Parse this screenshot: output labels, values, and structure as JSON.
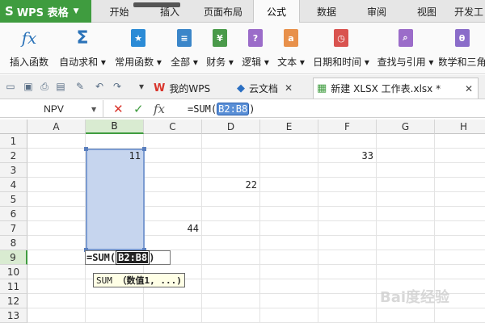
{
  "app": {
    "name": "WPS 表格",
    "logo": "S"
  },
  "menu_tabs": [
    {
      "label": "开始"
    },
    {
      "label": "插入"
    },
    {
      "label": "页面布局"
    },
    {
      "label": "公式"
    },
    {
      "label": "数据"
    },
    {
      "label": "审阅"
    },
    {
      "label": "视图"
    },
    {
      "label": "开发工"
    }
  ],
  "ribbon": [
    {
      "label": "插入函数",
      "icon": "fx-icon"
    },
    {
      "label": "自动求和",
      "icon": "sigma-icon",
      "color": "#2a72b8"
    },
    {
      "label": "常用函数",
      "icon": "star-doc-icon",
      "color": "#2b8bd6"
    },
    {
      "label": "全部",
      "icon": "list-doc-icon",
      "color": "#3b86c9"
    },
    {
      "label": "财务",
      "icon": "money-doc-icon",
      "color": "#4a9a4a"
    },
    {
      "label": "逻辑",
      "icon": "question-doc-icon",
      "color": "#9b6cc9"
    },
    {
      "label": "文本",
      "icon": "text-doc-icon",
      "color": "#e8904a"
    },
    {
      "label": "日期和时间",
      "icon": "clock-doc-icon",
      "color": "#d9534f"
    },
    {
      "label": "查找与引用",
      "icon": "search-doc-icon",
      "color": "#9b6cc9"
    },
    {
      "label": "数学和三角",
      "icon": "theta-doc-icon",
      "color": "#8a6cc9"
    }
  ],
  "doc_tabs": [
    {
      "label": "我的WPS",
      "icon": "wps-logo-icon"
    },
    {
      "label": "云文档",
      "icon": "cloud-doc-icon"
    },
    {
      "label": "新建 XLSX 工作表.xlsx *",
      "icon": "sheet-icon",
      "active": true
    }
  ],
  "formula_bar": {
    "name_box": "NPV",
    "formula_prefix": "=SUM(",
    "formula_ref": "B2:B8",
    "formula_suffix": ")"
  },
  "columns": [
    "A",
    "B",
    "C",
    "D",
    "E",
    "F",
    "G",
    "H"
  ],
  "rows": [
    "1",
    "2",
    "3",
    "4",
    "5",
    "6",
    "7",
    "8",
    "9",
    "10",
    "11",
    "12",
    "13"
  ],
  "cells": {
    "B2": "11",
    "D4": "22",
    "C7": "44",
    "F2": "33"
  },
  "edit_cell": {
    "prefix": "=SUM(",
    "ref": "B2:B8",
    "suffix": ")"
  },
  "tooltip": {
    "fn": "SUM",
    "args": "（数值1, ...)"
  },
  "watermark": "Bai度经验"
}
